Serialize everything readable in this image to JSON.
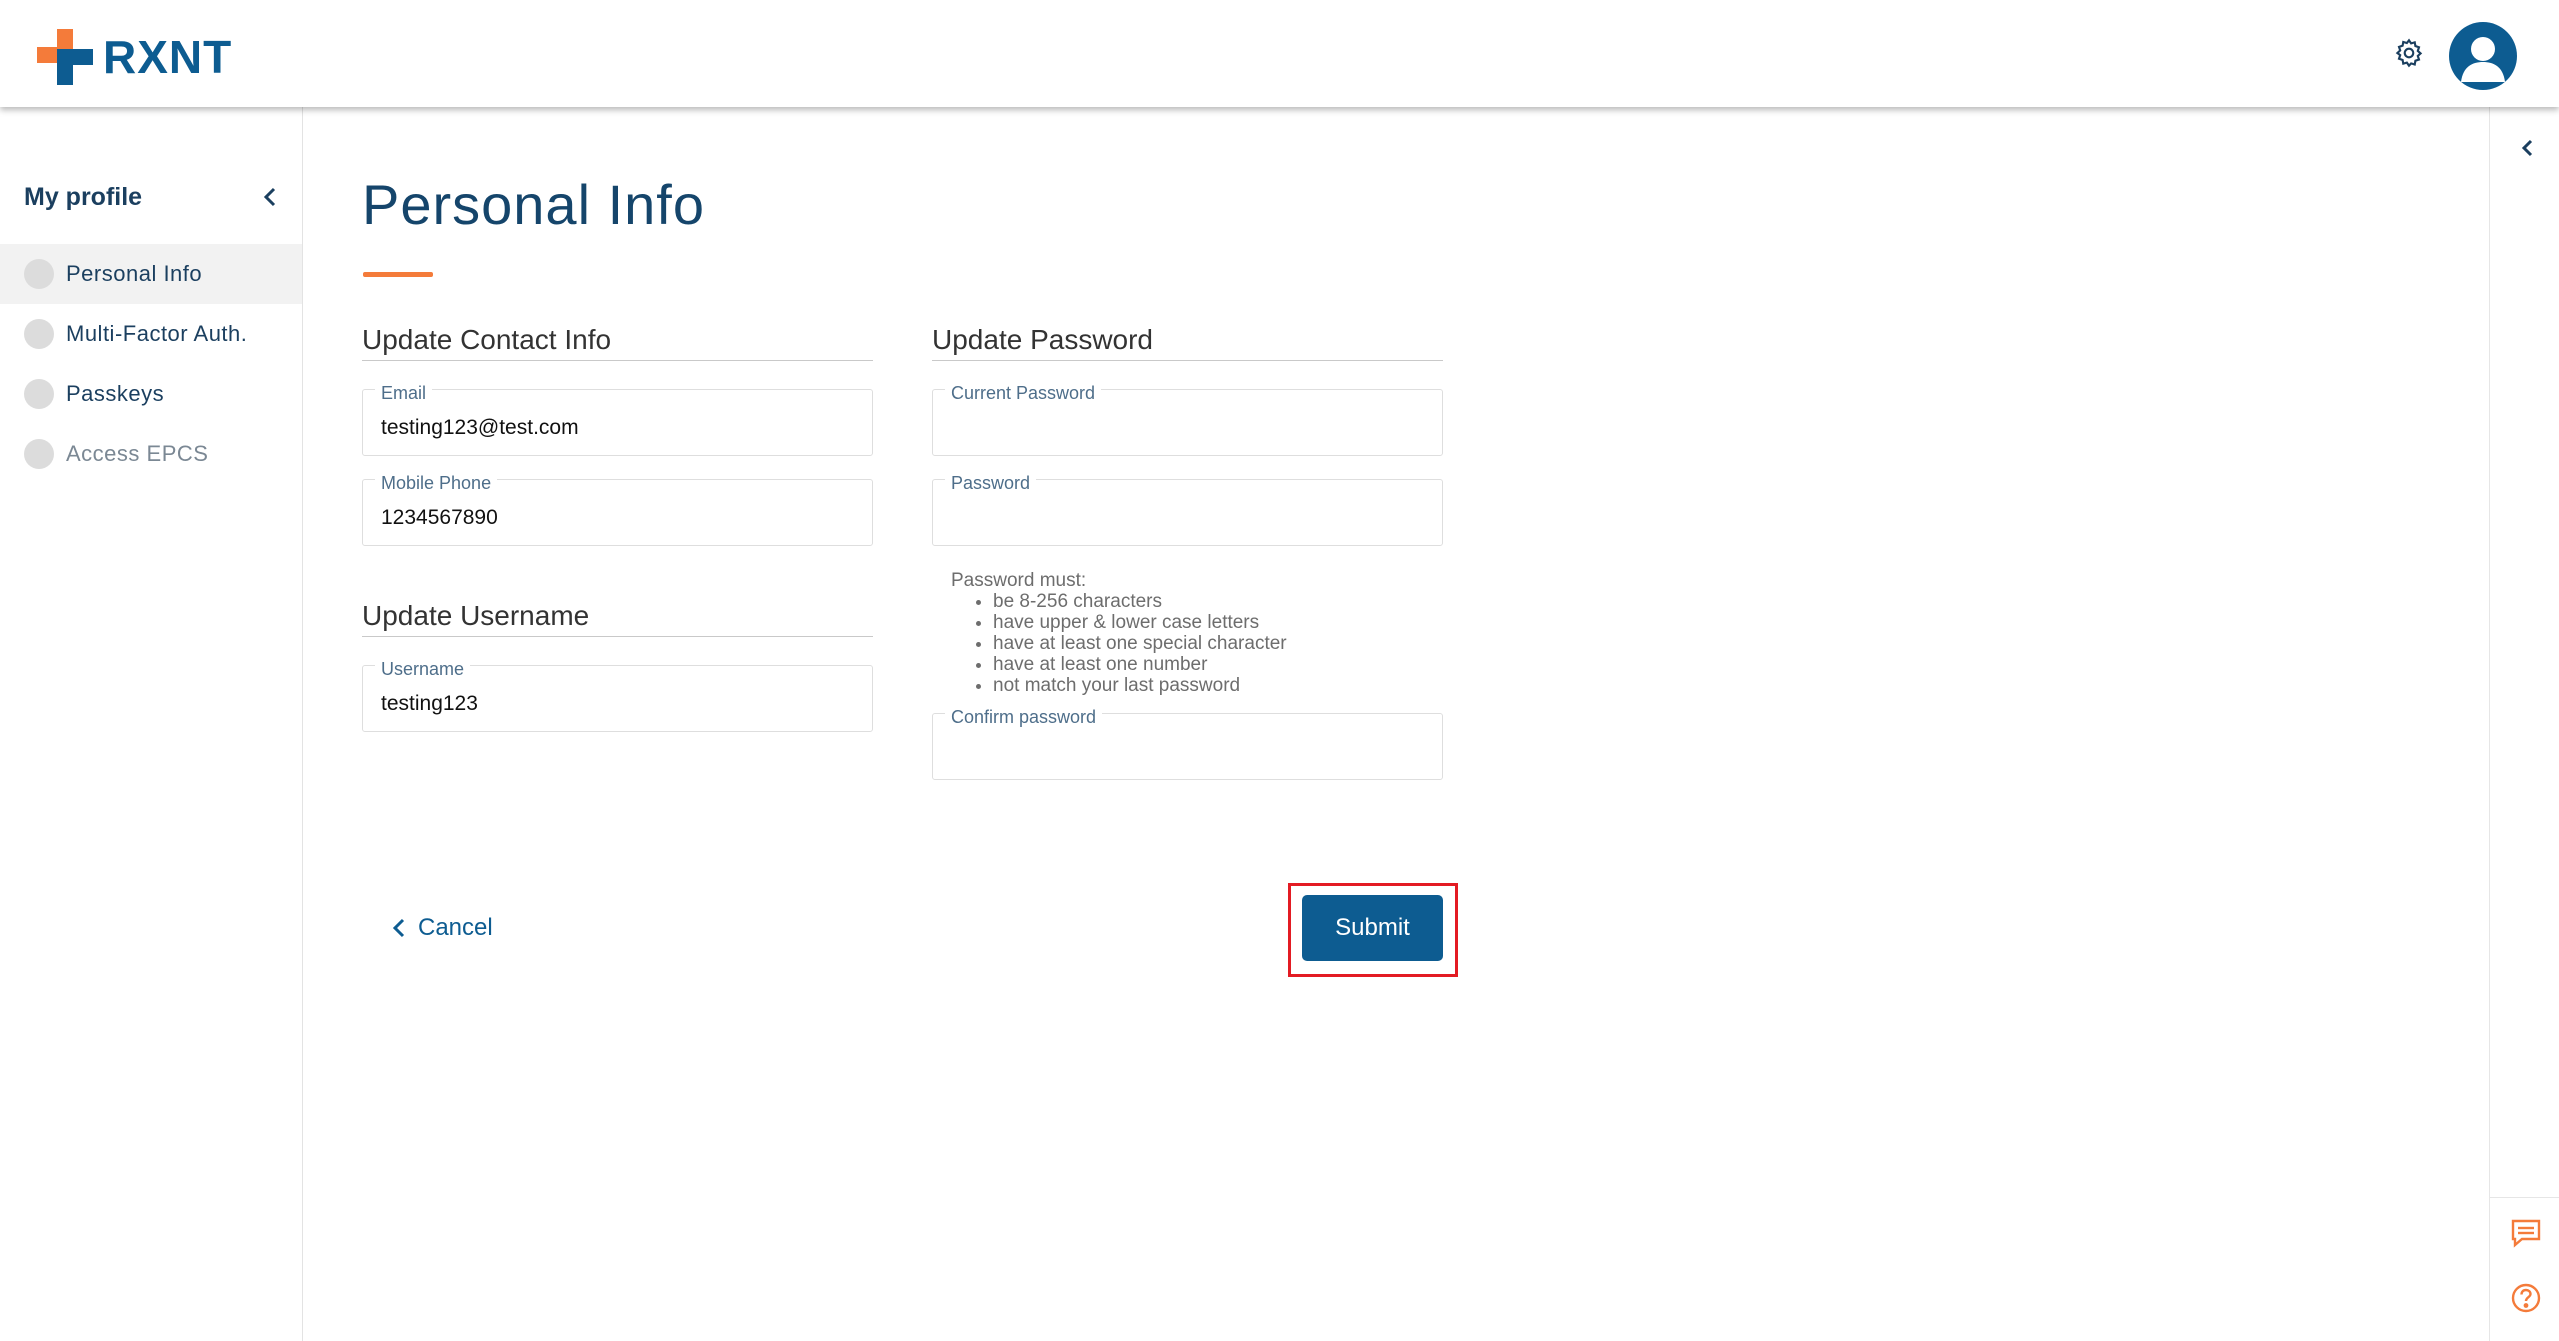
{
  "header": {
    "logo_text": "RXNT",
    "settings_icon": "gear-icon",
    "avatar_icon": "user-avatar-icon",
    "brand_color": "#0d5c91",
    "accent_color": "#f47b3a"
  },
  "sidebar": {
    "title": "My profile",
    "items": [
      {
        "label": "Personal Info",
        "active": true
      },
      {
        "label": "Multi-Factor Auth.",
        "active": false
      },
      {
        "label": "Passkeys",
        "active": false
      },
      {
        "label": "Access EPCS",
        "active": false,
        "muted": true
      }
    ]
  },
  "main": {
    "title": "Personal Info",
    "contact": {
      "section_title": "Update Contact Info",
      "email_label": "Email",
      "email_value": "testing123@test.com",
      "phone_label": "Mobile Phone",
      "phone_value": "1234567890"
    },
    "username": {
      "section_title": "Update Username",
      "username_label": "Username",
      "username_value": "testing123"
    },
    "password": {
      "section_title": "Update Password",
      "current_label": "Current Password",
      "current_value": "",
      "new_label": "Password",
      "new_value": "",
      "rules_heading": "Password must:",
      "rules": [
        "be 8-256 characters",
        "have upper & lower case letters",
        "have at least one special character",
        "have at least one number",
        "not match your last password"
      ],
      "confirm_label": "Confirm password",
      "confirm_value": ""
    },
    "actions": {
      "cancel_label": "Cancel",
      "submit_label": "Submit",
      "highlight_color": "#e31b23"
    }
  },
  "right_rail": {
    "collapse_icon": "chevron-left-icon",
    "chat_icon": "chat-icon",
    "help_icon": "help-icon"
  }
}
